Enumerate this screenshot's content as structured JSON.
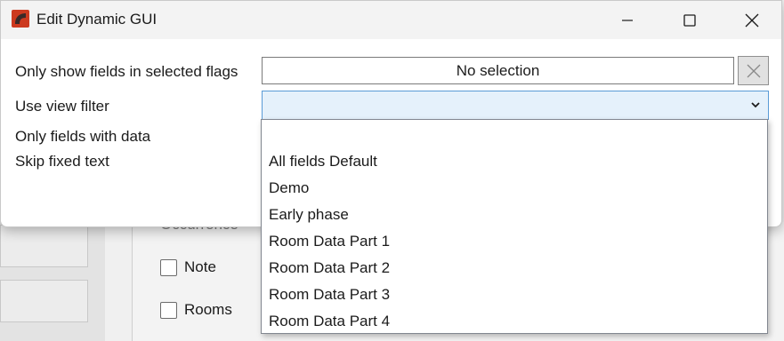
{
  "window": {
    "title": "Edit Dynamic GUI",
    "icon": "app-logo-icon",
    "accent_color": "#cc3a1f"
  },
  "form": {
    "flags_label": "Only show fields in selected flags",
    "flags_value": "No selection",
    "view_filter_label": "Use view filter",
    "view_filter_value": "",
    "fields_with_data_label": "Only fields with data",
    "skip_fixed_text_label": "Skip fixed text"
  },
  "view_filter_options": [
    "",
    "All fields Default",
    "Demo",
    "Early phase",
    "Room Data Part 1",
    "Room Data Part 2",
    "Room Data Part 3",
    "Room Data Part 4"
  ],
  "background": {
    "partial_label": "Occurrence",
    "checkbox_items": [
      "Note",
      "Rooms"
    ]
  }
}
